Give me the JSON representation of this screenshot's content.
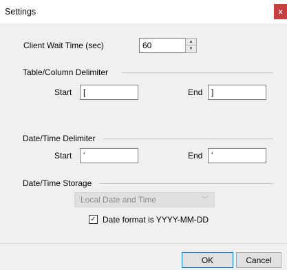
{
  "window": {
    "title": "Settings",
    "close_glyph": "x"
  },
  "client_wait": {
    "label": "Client Wait Time (sec)",
    "value": "60",
    "spinner_up": "▲",
    "spinner_down": "▼"
  },
  "table_column_delimiter": {
    "group_label": "Table/Column Delimiter",
    "start_label": "Start",
    "start_value": "[",
    "end_label": "End",
    "end_value": "]"
  },
  "date_time_delimiter": {
    "group_label": "Date/Time Delimiter",
    "start_label": "Start",
    "start_value": "'",
    "end_label": "End",
    "end_value": "'"
  },
  "date_time_storage": {
    "group_label": "Date/Time Storage",
    "dropdown_value": "Local Date and Time",
    "dropdown_chevron": "﹀",
    "checkbox_label": "Date format is YYYY-MM-DD",
    "checkbox_checked": true,
    "checkbox_glyph": "✓"
  },
  "buttons": {
    "ok": "OK",
    "cancel": "Cancel"
  },
  "colors": {
    "close_bg": "#c74040",
    "default_button_border": "#0078d7",
    "window_bg": "#f0f0f0"
  },
  "icons": {
    "close": "close-icon",
    "spinner_up": "arrow-up-icon",
    "spinner_down": "arrow-down-icon",
    "dropdown": "chevron-down-icon",
    "check": "check-icon"
  }
}
